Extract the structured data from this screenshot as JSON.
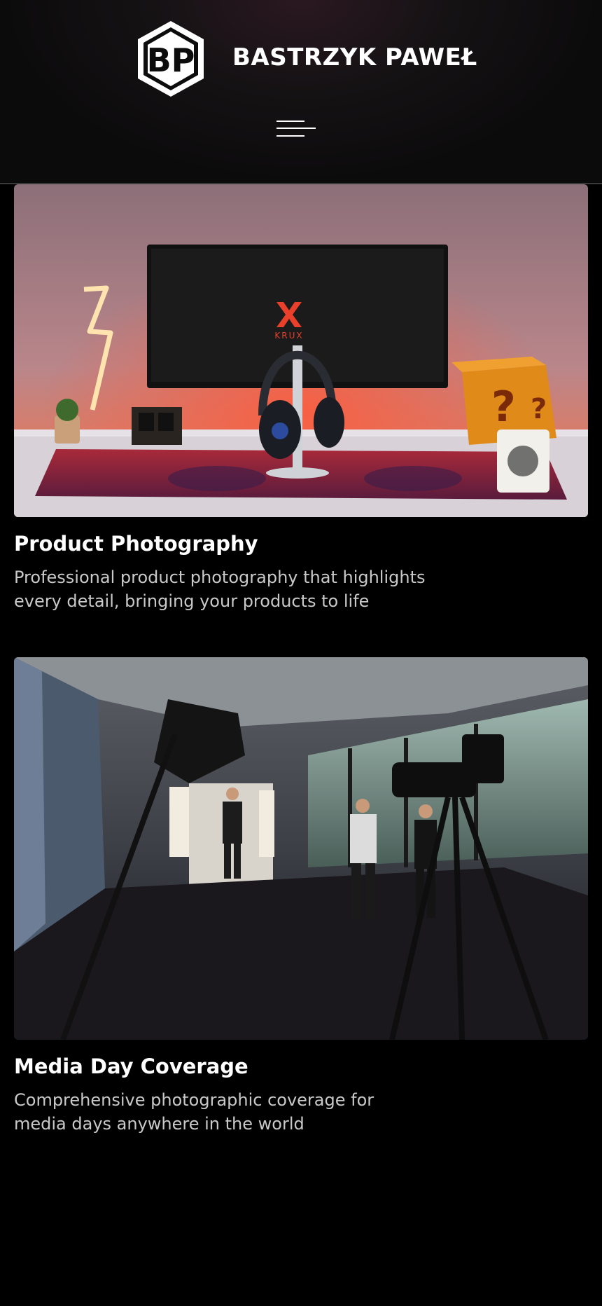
{
  "header": {
    "logo_icon": "bp-hexagon-logo",
    "brand_name": "BASTRZYK PAWEŁ",
    "menu_icon": "hamburger-menu-icon"
  },
  "cards": [
    {
      "title": "Product Photography",
      "description": "Professional product photography that highlights every detail, bringing your products to life",
      "image_subject": "desk setup with monitor showing KRUX logo, headphones on stand, neon lightning bolt, question-mark block lamp and mug",
      "image_logo_text": "KRUX"
    },
    {
      "title": "Media Day Coverage",
      "description": "Comprehensive photographic coverage for media days anywhere in the world",
      "image_subject": "photo studio with softboxes, camera on tripod and people posing"
    }
  ],
  "colors": {
    "background": "#000000",
    "text_primary": "#ffffff",
    "text_secondary": "#c9c9c9",
    "accent_red": "#e8402a"
  }
}
